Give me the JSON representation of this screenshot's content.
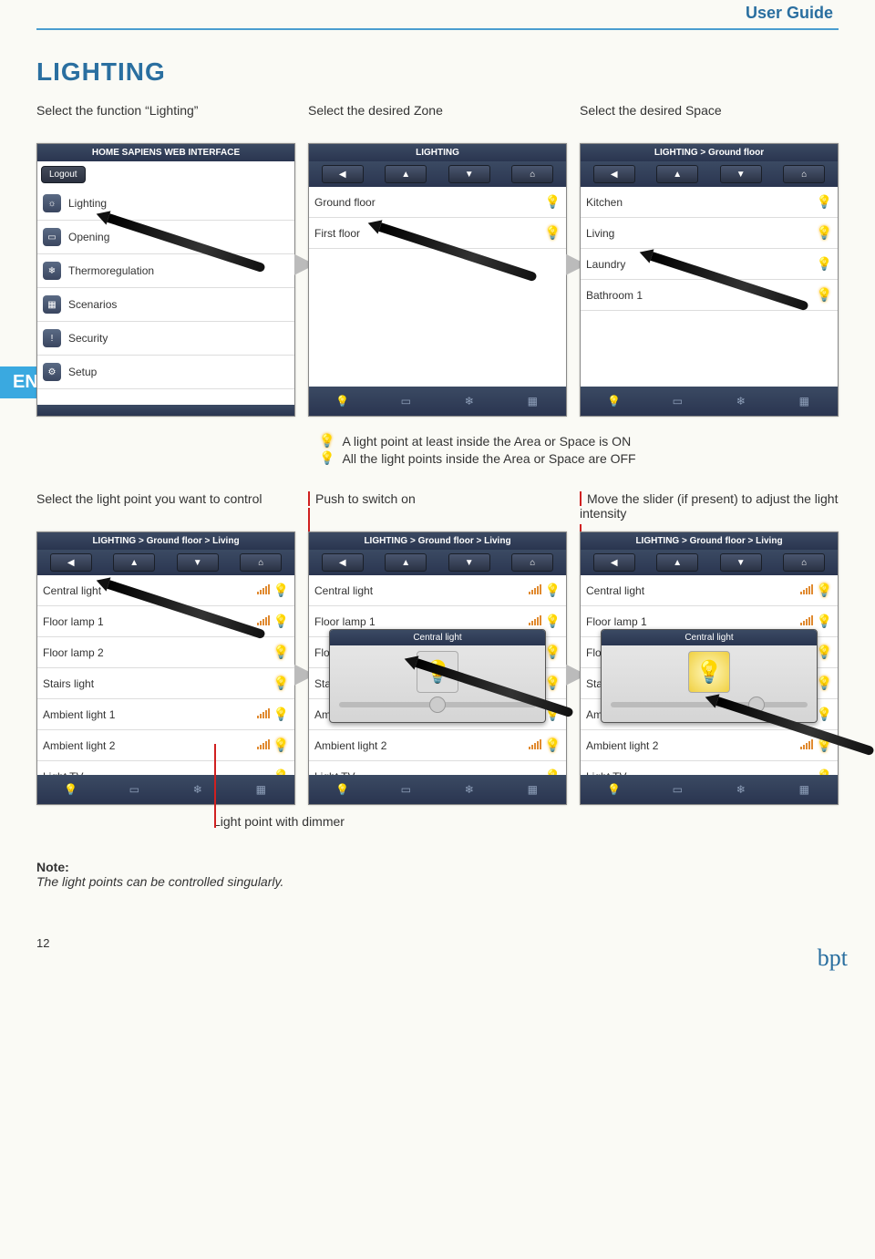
{
  "header": {
    "title": "User Guide"
  },
  "section_title": "LIGHTING",
  "lang_tag": "EN",
  "step_captions": {
    "s1": "Select the function “Lighting”",
    "s2": "Select the desired Zone",
    "s3": "Select the desired Space"
  },
  "screen1": {
    "title": "HOME SAPIENS WEB INTERFACE",
    "logout": "Logout",
    "items": [
      {
        "label": "Lighting"
      },
      {
        "label": "Opening"
      },
      {
        "label": "Thermoregulation"
      },
      {
        "label": "Scenarios"
      },
      {
        "label": "Security"
      },
      {
        "label": "Setup"
      }
    ]
  },
  "screen2": {
    "title": "LIGHTING",
    "items": [
      {
        "label": "Ground floor",
        "bulb": "off"
      },
      {
        "label": "First floor",
        "bulb": "on"
      }
    ]
  },
  "screen3": {
    "title": "LIGHTING > Ground floor",
    "items": [
      {
        "label": "Kitchen",
        "bulb": "off"
      },
      {
        "label": "Living",
        "bulb": "on"
      },
      {
        "label": "Laundry",
        "bulb": "off"
      },
      {
        "label": "Bathroom 1",
        "bulb": "on"
      }
    ]
  },
  "legend": {
    "on": "A light point at least inside the Area or Space is ON",
    "off": "All the light points inside the Area or Space are OFF"
  },
  "step_captions2": {
    "s4": "Select the  light point you want to control",
    "s5": "Push to switch on",
    "s6": "Move the  slider (if present) to adjust  the light intensity"
  },
  "screen456_title": "LIGHTING > Ground floor > Living",
  "light_points": [
    {
      "label": "Central light",
      "dimmer": true,
      "bulb": "off"
    },
    {
      "label": "Floor lamp 1",
      "dimmer": true,
      "bulb": "off"
    },
    {
      "label": "Floor lamp 2",
      "dimmer": false,
      "bulb": "on"
    },
    {
      "label": "Stairs light",
      "dimmer": false,
      "bulb": "on"
    },
    {
      "label": "Ambient light 1",
      "dimmer": true,
      "bulb": "off"
    },
    {
      "label": "Ambient light 2",
      "dimmer": true,
      "bulb": "on"
    },
    {
      "label": "Light TV",
      "dimmer": false,
      "bulb": "off"
    }
  ],
  "popup": {
    "title": "Central light"
  },
  "dimmer_caption": "Light point with dimmer",
  "note": {
    "title": "Note:",
    "body": "The light points can be controlled singularly."
  },
  "page_number": "12",
  "logo": "bpt"
}
